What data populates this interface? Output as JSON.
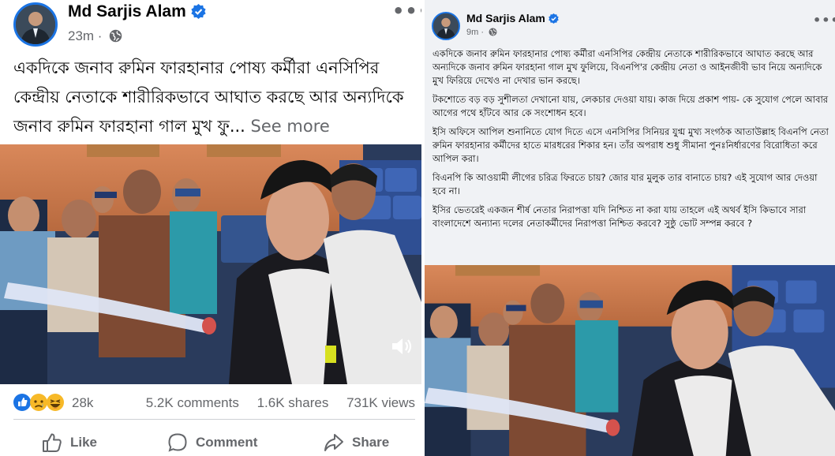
{
  "post_left": {
    "author": "Md Sarjis Alam",
    "time": "23m",
    "more": "•••",
    "text": "একদিকে জনাব রুমিন ফারহানার পোষ্য কর্মীরা এনসিপির কেন্দ্রীয় নেতাকে শারীরিকভাবে আঘাত করছে আর অন্যদিকে জনাব রুমিন ফারহানা গাল মুখ ফু...",
    "see_more": "See more",
    "reactions_count": "28k",
    "comments": "5.2K comments",
    "shares": "1.6K shares",
    "views": "731K views",
    "actions": {
      "like": "Like",
      "comment": "Comment",
      "share": "Share"
    },
    "icons": [
      "verified-badge",
      "globe-icon",
      "like-reaction",
      "sad-reaction",
      "haha-reaction",
      "volume-icon",
      "thumbs-up-icon",
      "comment-icon",
      "share-icon"
    ]
  },
  "post_right": {
    "author": "Md Sarjis Alam",
    "time": "9m",
    "more": "•••",
    "paragraphs": [
      "একদিকে জনাব রুমিন ফারহানার পোষ্য কর্মীরা এনসিপির কেন্দ্রীয় নেতাকে শারীরিকভাবে আঘাত করছে আর অন্যদিকে জনাব রুমিন ফারহানা গাল মুখ ফুলিয়ে, বিএনপি'র কেন্দ্রীয় নেতা ও আইনজীবী ভাব নিয়ে অন্যদিকে মুখ ফিরিয়ে দেখেও না দেখার ভান করছে।",
      "টকশোতে বড় বড় সুশীলতা দেখানো যায়, লেকচার দেওয়া যায়। কাজ দিয়ে প্রকাশ পায়- কে সুযোগ পেলে আবার আগের পথে হাঁটবে আর কে সংশোধন হবে।",
      "ইসি অফিসে আপিল শুনানিতে যোগ দিতে এসে এনসিপির সিনিয়র যুগ্ম মুখ্য সংগঠক আতাউল্লাহ বিএনপি নেতা রুমিন ফারহানার কর্মীদের হাতে মারধরের শিকার হন। তাঁর অপরাধ শুধু সীমানা পুনঃনির্ধারণের বিরোধিতা করে আপিল করা।",
      "বিএনপি কি আওয়ামী লীগের চরিত্র ফিরতে চায়? জোর যার মুলুক তার বানাতে চায়? এই সুযোগ আর দেওয়া হবে না।",
      "ইসির ভেতরেই একজন শীর্ষ নেতার নিরাপত্তা যদি নিশ্চিত না করা যায় তাহলে এই অথর্ব ইসি কিভাবে সারা বাংলাদেশে অন্যান্য দলের নেতাকর্মীদের নিরাপত্তা নিশ্চিত করবে? সুষ্ঠু ভোট সম্পন্ন করবে ?"
    ],
    "icons": [
      "verified-badge",
      "globe-icon"
    ]
  },
  "colors": {
    "facebook_blue": "#1b74e4",
    "meta_gray": "#65676b",
    "text": "#050505",
    "right_bg": "#f0f2f5"
  }
}
